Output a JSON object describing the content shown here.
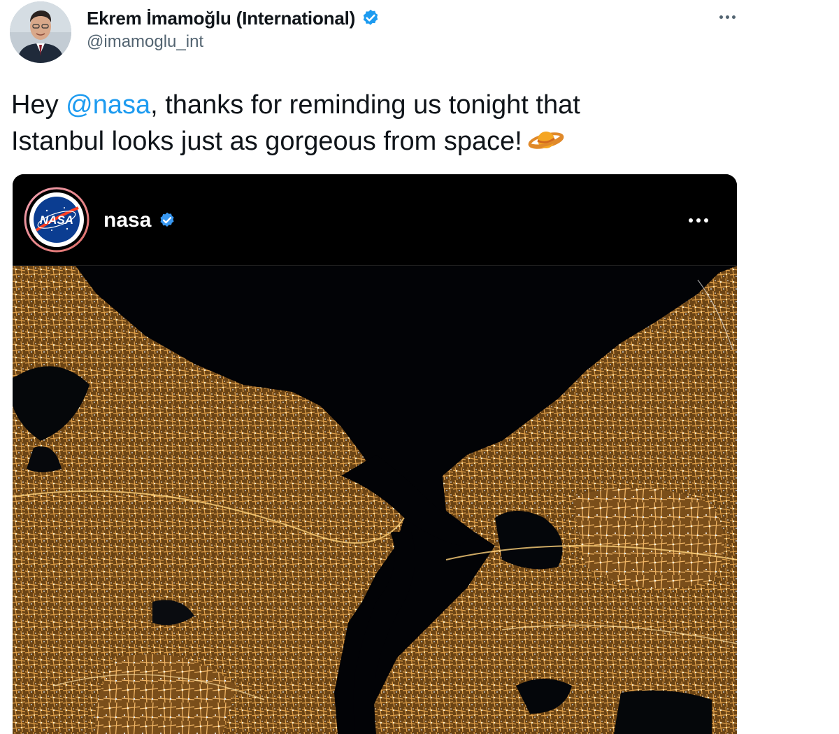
{
  "author": {
    "display_name": "Ekrem İmamoğlu (International)",
    "handle": "@imamoglu_int",
    "verified": true,
    "avatar_icon": "profile-photo"
  },
  "tweet": {
    "text_before": "Hey ",
    "mention": "@nasa",
    "text_line1_after": ", thanks for reminding us tonight that",
    "text_line2": "Istanbul looks just as gorgeous from space!",
    "emoji": "ringed-planet-icon"
  },
  "embed": {
    "username": "nasa",
    "verified": true,
    "avatar_icon": "nasa-logo",
    "avatar_lettering": "NASA",
    "image": "night-satellite-photo-istanbul"
  },
  "colors": {
    "link": "#1d9bf0",
    "secondary_text": "#536471",
    "verified": "#1d9bf0",
    "embed_background": "#000000",
    "city_lights": "#c88a3a"
  }
}
